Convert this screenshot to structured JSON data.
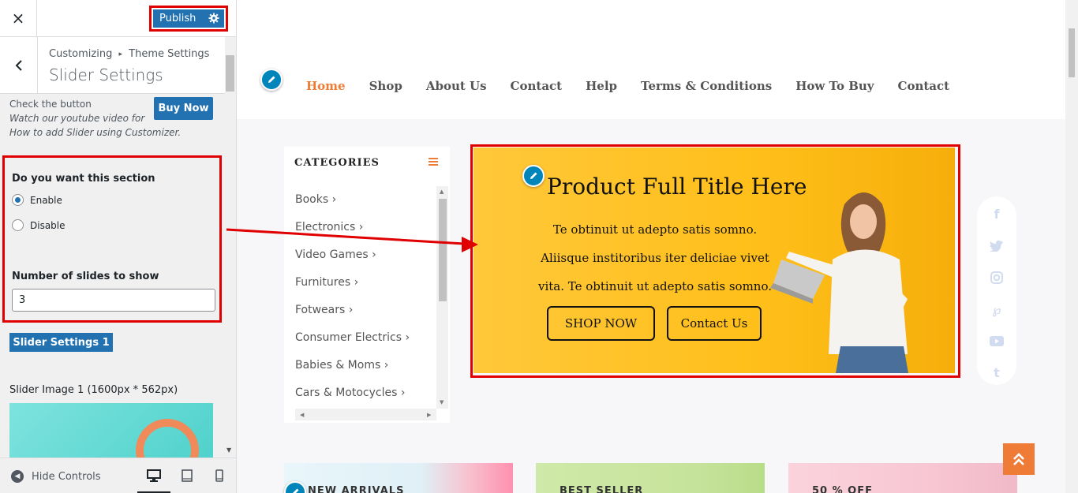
{
  "customizer": {
    "close_label": "×",
    "publish_label": "Publish",
    "breadcrumb_root": "Customizing",
    "breadcrumb_sep": "▸",
    "breadcrumb_section": "Theme Settings",
    "panel_title": "Slider Settings",
    "check_text": "Check the button",
    "watch_text_1": "Watch our youtube video for",
    "watch_text_2": "How to add Slider using Customizer.",
    "buy_now_label": "Buy Now",
    "section_question": "Do you want this section",
    "enable_label": "Enable",
    "disable_label": "Disable",
    "slides_label": "Number of slides to show",
    "slides_value": "3",
    "slider_settings_btn": "Slider Settings 1",
    "slider_image_label": "Slider Image 1 (1600px * 562px)",
    "hide_controls_label": "Hide Controls"
  },
  "site": {
    "nav": [
      "Home",
      "Shop",
      "About Us",
      "Contact",
      "Help",
      "Terms & Conditions",
      "How To Buy",
      "Contact"
    ],
    "categories_title": "CATEGORIES",
    "categories": [
      {
        "label": "Books"
      },
      {
        "label": "Electronics"
      },
      {
        "label": "Video Games"
      },
      {
        "label": "Furnitures"
      },
      {
        "label": "Fotwears"
      },
      {
        "label": "Consumer Electrics"
      },
      {
        "label": "Babies & Moms"
      },
      {
        "label": "Cars & Motocycles"
      }
    ],
    "banner": {
      "title": "Product Full Title Here",
      "line1": "Te obtinuit ut adepto satis somno.",
      "line2": "Aliisque institoribus iter deliciae vivet",
      "line3": "vita. Te obtinuit ut adepto satis somno.",
      "shop_label": "SHOP NOW",
      "contact_label": "Contact Us"
    },
    "promos": [
      {
        "text": "NEW ARRIVALS"
      },
      {
        "text": "BEST SELLER"
      },
      {
        "text": "50 % OFF"
      }
    ]
  },
  "colors": {
    "wp_blue": "#2271b1",
    "highlight_red": "#e00000",
    "nav_active": "#ee7c36",
    "banner_yellow": "#ffc83a"
  }
}
